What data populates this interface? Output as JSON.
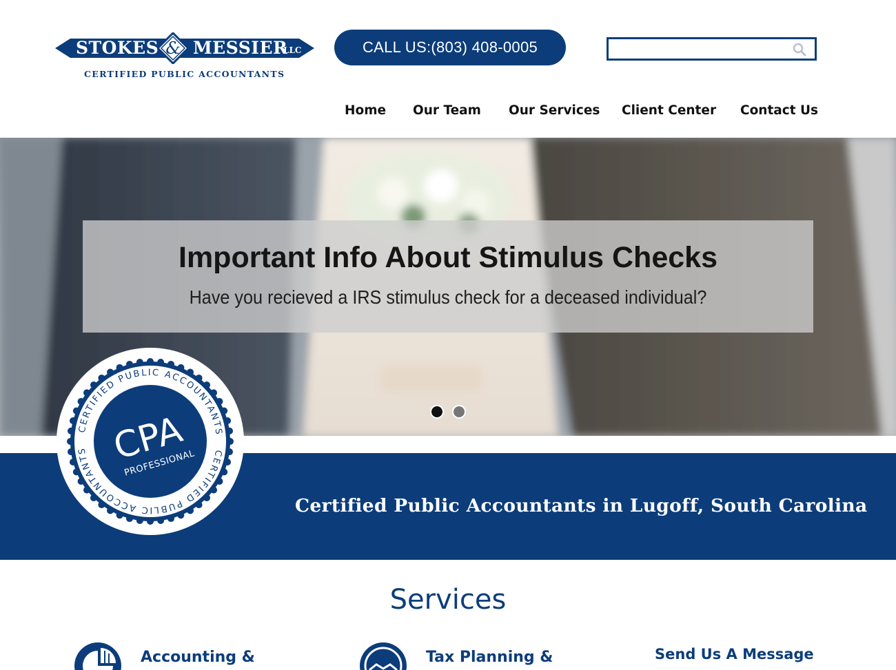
{
  "header": {
    "logo": {
      "name_left": "STOKES",
      "name_right": "MESSIER",
      "suffix": "LLC",
      "ampersand": "&",
      "tagline": "CERTIFIED PUBLIC ACCOUNTANTS"
    },
    "call_button": "CALL US:(803) 408-0005",
    "search": {
      "placeholder": "",
      "value": "",
      "icon": "search-icon"
    }
  },
  "nav": {
    "items": [
      {
        "label": "Home"
      },
      {
        "label": "Our Team"
      },
      {
        "label": "Our Services"
      },
      {
        "label": "Client Center"
      },
      {
        "label": "Contact Us"
      }
    ]
  },
  "hero": {
    "title": "Important Info About Stimulus Checks",
    "subtitle": "Have you recieved a IRS stimulus check for a deceased individual?",
    "slides": 2,
    "active_slide": 1
  },
  "seal": {
    "big": "CPA",
    "small": "PROFESSIONAL",
    "ring_text": "CERTIFIED PUBLIC ACCOUNTANTS"
  },
  "band": {
    "text": "Certified Public Accountants in Lugoff, South Carolina"
  },
  "services": {
    "title": "Services",
    "items": [
      {
        "label": "Accounting &",
        "icon": "pie-chart-icon"
      },
      {
        "label": "Tax Planning &",
        "icon": "handshake-icon"
      }
    ],
    "message_title": "Send Us A Message"
  },
  "colors": {
    "brand_navy": "#0c3d7a",
    "white": "#ffffff",
    "hero_panel": "#cdcdcd"
  }
}
